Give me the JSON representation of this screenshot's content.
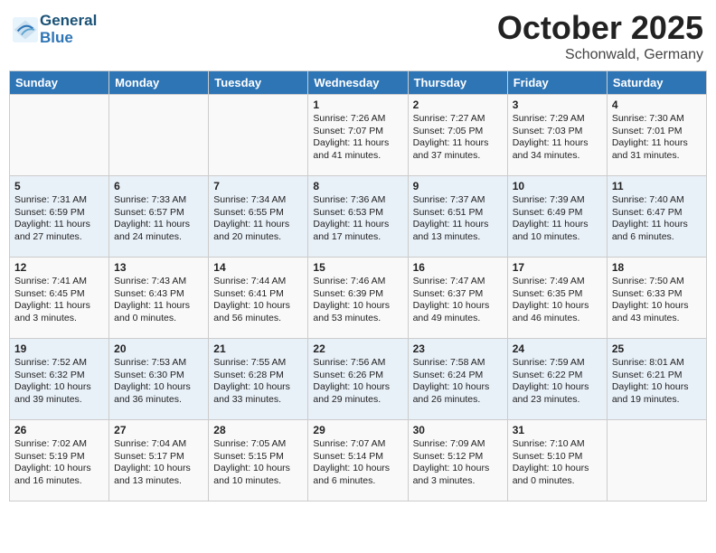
{
  "header": {
    "logo_line1": "General",
    "logo_line2": "Blue",
    "month": "October 2025",
    "location": "Schonwald, Germany"
  },
  "days_of_week": [
    "Sunday",
    "Monday",
    "Tuesday",
    "Wednesday",
    "Thursday",
    "Friday",
    "Saturday"
  ],
  "weeks": [
    [
      {
        "day": "",
        "info": ""
      },
      {
        "day": "",
        "info": ""
      },
      {
        "day": "",
        "info": ""
      },
      {
        "day": "1",
        "info": "Sunrise: 7:26 AM\nSunset: 7:07 PM\nDaylight: 11 hours and 41 minutes."
      },
      {
        "day": "2",
        "info": "Sunrise: 7:27 AM\nSunset: 7:05 PM\nDaylight: 11 hours and 37 minutes."
      },
      {
        "day": "3",
        "info": "Sunrise: 7:29 AM\nSunset: 7:03 PM\nDaylight: 11 hours and 34 minutes."
      },
      {
        "day": "4",
        "info": "Sunrise: 7:30 AM\nSunset: 7:01 PM\nDaylight: 11 hours and 31 minutes."
      }
    ],
    [
      {
        "day": "5",
        "info": "Sunrise: 7:31 AM\nSunset: 6:59 PM\nDaylight: 11 hours and 27 minutes."
      },
      {
        "day": "6",
        "info": "Sunrise: 7:33 AM\nSunset: 6:57 PM\nDaylight: 11 hours and 24 minutes."
      },
      {
        "day": "7",
        "info": "Sunrise: 7:34 AM\nSunset: 6:55 PM\nDaylight: 11 hours and 20 minutes."
      },
      {
        "day": "8",
        "info": "Sunrise: 7:36 AM\nSunset: 6:53 PM\nDaylight: 11 hours and 17 minutes."
      },
      {
        "day": "9",
        "info": "Sunrise: 7:37 AM\nSunset: 6:51 PM\nDaylight: 11 hours and 13 minutes."
      },
      {
        "day": "10",
        "info": "Sunrise: 7:39 AM\nSunset: 6:49 PM\nDaylight: 11 hours and 10 minutes."
      },
      {
        "day": "11",
        "info": "Sunrise: 7:40 AM\nSunset: 6:47 PM\nDaylight: 11 hours and 6 minutes."
      }
    ],
    [
      {
        "day": "12",
        "info": "Sunrise: 7:41 AM\nSunset: 6:45 PM\nDaylight: 11 hours and 3 minutes."
      },
      {
        "day": "13",
        "info": "Sunrise: 7:43 AM\nSunset: 6:43 PM\nDaylight: 11 hours and 0 minutes."
      },
      {
        "day": "14",
        "info": "Sunrise: 7:44 AM\nSunset: 6:41 PM\nDaylight: 10 hours and 56 minutes."
      },
      {
        "day": "15",
        "info": "Sunrise: 7:46 AM\nSunset: 6:39 PM\nDaylight: 10 hours and 53 minutes."
      },
      {
        "day": "16",
        "info": "Sunrise: 7:47 AM\nSunset: 6:37 PM\nDaylight: 10 hours and 49 minutes."
      },
      {
        "day": "17",
        "info": "Sunrise: 7:49 AM\nSunset: 6:35 PM\nDaylight: 10 hours and 46 minutes."
      },
      {
        "day": "18",
        "info": "Sunrise: 7:50 AM\nSunset: 6:33 PM\nDaylight: 10 hours and 43 minutes."
      }
    ],
    [
      {
        "day": "19",
        "info": "Sunrise: 7:52 AM\nSunset: 6:32 PM\nDaylight: 10 hours and 39 minutes."
      },
      {
        "day": "20",
        "info": "Sunrise: 7:53 AM\nSunset: 6:30 PM\nDaylight: 10 hours and 36 minutes."
      },
      {
        "day": "21",
        "info": "Sunrise: 7:55 AM\nSunset: 6:28 PM\nDaylight: 10 hours and 33 minutes."
      },
      {
        "day": "22",
        "info": "Sunrise: 7:56 AM\nSunset: 6:26 PM\nDaylight: 10 hours and 29 minutes."
      },
      {
        "day": "23",
        "info": "Sunrise: 7:58 AM\nSunset: 6:24 PM\nDaylight: 10 hours and 26 minutes."
      },
      {
        "day": "24",
        "info": "Sunrise: 7:59 AM\nSunset: 6:22 PM\nDaylight: 10 hours and 23 minutes."
      },
      {
        "day": "25",
        "info": "Sunrise: 8:01 AM\nSunset: 6:21 PM\nDaylight: 10 hours and 19 minutes."
      }
    ],
    [
      {
        "day": "26",
        "info": "Sunrise: 7:02 AM\nSunset: 5:19 PM\nDaylight: 10 hours and 16 minutes."
      },
      {
        "day": "27",
        "info": "Sunrise: 7:04 AM\nSunset: 5:17 PM\nDaylight: 10 hours and 13 minutes."
      },
      {
        "day": "28",
        "info": "Sunrise: 7:05 AM\nSunset: 5:15 PM\nDaylight: 10 hours and 10 minutes."
      },
      {
        "day": "29",
        "info": "Sunrise: 7:07 AM\nSunset: 5:14 PM\nDaylight: 10 hours and 6 minutes."
      },
      {
        "day": "30",
        "info": "Sunrise: 7:09 AM\nSunset: 5:12 PM\nDaylight: 10 hours and 3 minutes."
      },
      {
        "day": "31",
        "info": "Sunrise: 7:10 AM\nSunset: 5:10 PM\nDaylight: 10 hours and 0 minutes."
      },
      {
        "day": "",
        "info": ""
      }
    ]
  ]
}
